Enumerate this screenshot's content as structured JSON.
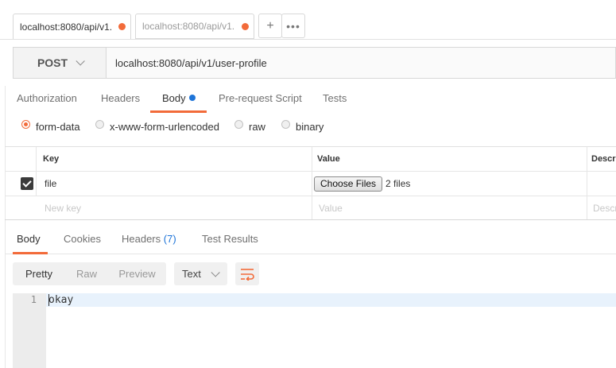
{
  "tabs": [
    {
      "label": "localhost:8080/api/v1.",
      "active": true,
      "unsaved": true
    },
    {
      "label": "localhost:8080/api/v1.",
      "active": false,
      "unsaved": true
    }
  ],
  "tab_actions": {
    "new_icon": "plus-icon",
    "more_icon": "more-horizontal-icon",
    "new_glyph": "+",
    "more_glyph": "•••"
  },
  "request": {
    "method": "POST",
    "url": "localhost:8080/api/v1/user-profile"
  },
  "request_tabs": [
    {
      "label": "Authorization"
    },
    {
      "label": "Headers"
    },
    {
      "label": "Body",
      "active": true,
      "indicator": true
    },
    {
      "label": "Pre-request Script"
    },
    {
      "label": "Tests"
    }
  ],
  "body_types": [
    {
      "label": "form-data",
      "checked": true
    },
    {
      "label": "x-www-form-urlencoded",
      "checked": false
    },
    {
      "label": "raw",
      "checked": false
    },
    {
      "label": "binary",
      "checked": false
    }
  ],
  "form_table": {
    "headers": {
      "key": "Key",
      "value": "Value",
      "description": "Descri"
    },
    "rows": [
      {
        "checked": true,
        "key": "file",
        "button_label": "Choose Files",
        "files_text": "2 files"
      }
    ],
    "new_row": {
      "key_placeholder": "New key",
      "value_placeholder": "Value",
      "description_placeholder": "Descri"
    }
  },
  "response_tabs": [
    {
      "label": "Body",
      "active": true
    },
    {
      "label": "Cookies"
    },
    {
      "label": "Headers",
      "count": "(7)"
    },
    {
      "label": "Test Results"
    }
  ],
  "view_modes": [
    {
      "label": "Pretty",
      "active": true
    },
    {
      "label": "Raw"
    },
    {
      "label": "Preview"
    }
  ],
  "format": {
    "selected": "Text"
  },
  "editor": {
    "lines": [
      {
        "number": "1",
        "text": "okay"
      }
    ]
  },
  "colors": {
    "accent": "#f26b3a",
    "blue": "#1e74d8"
  }
}
